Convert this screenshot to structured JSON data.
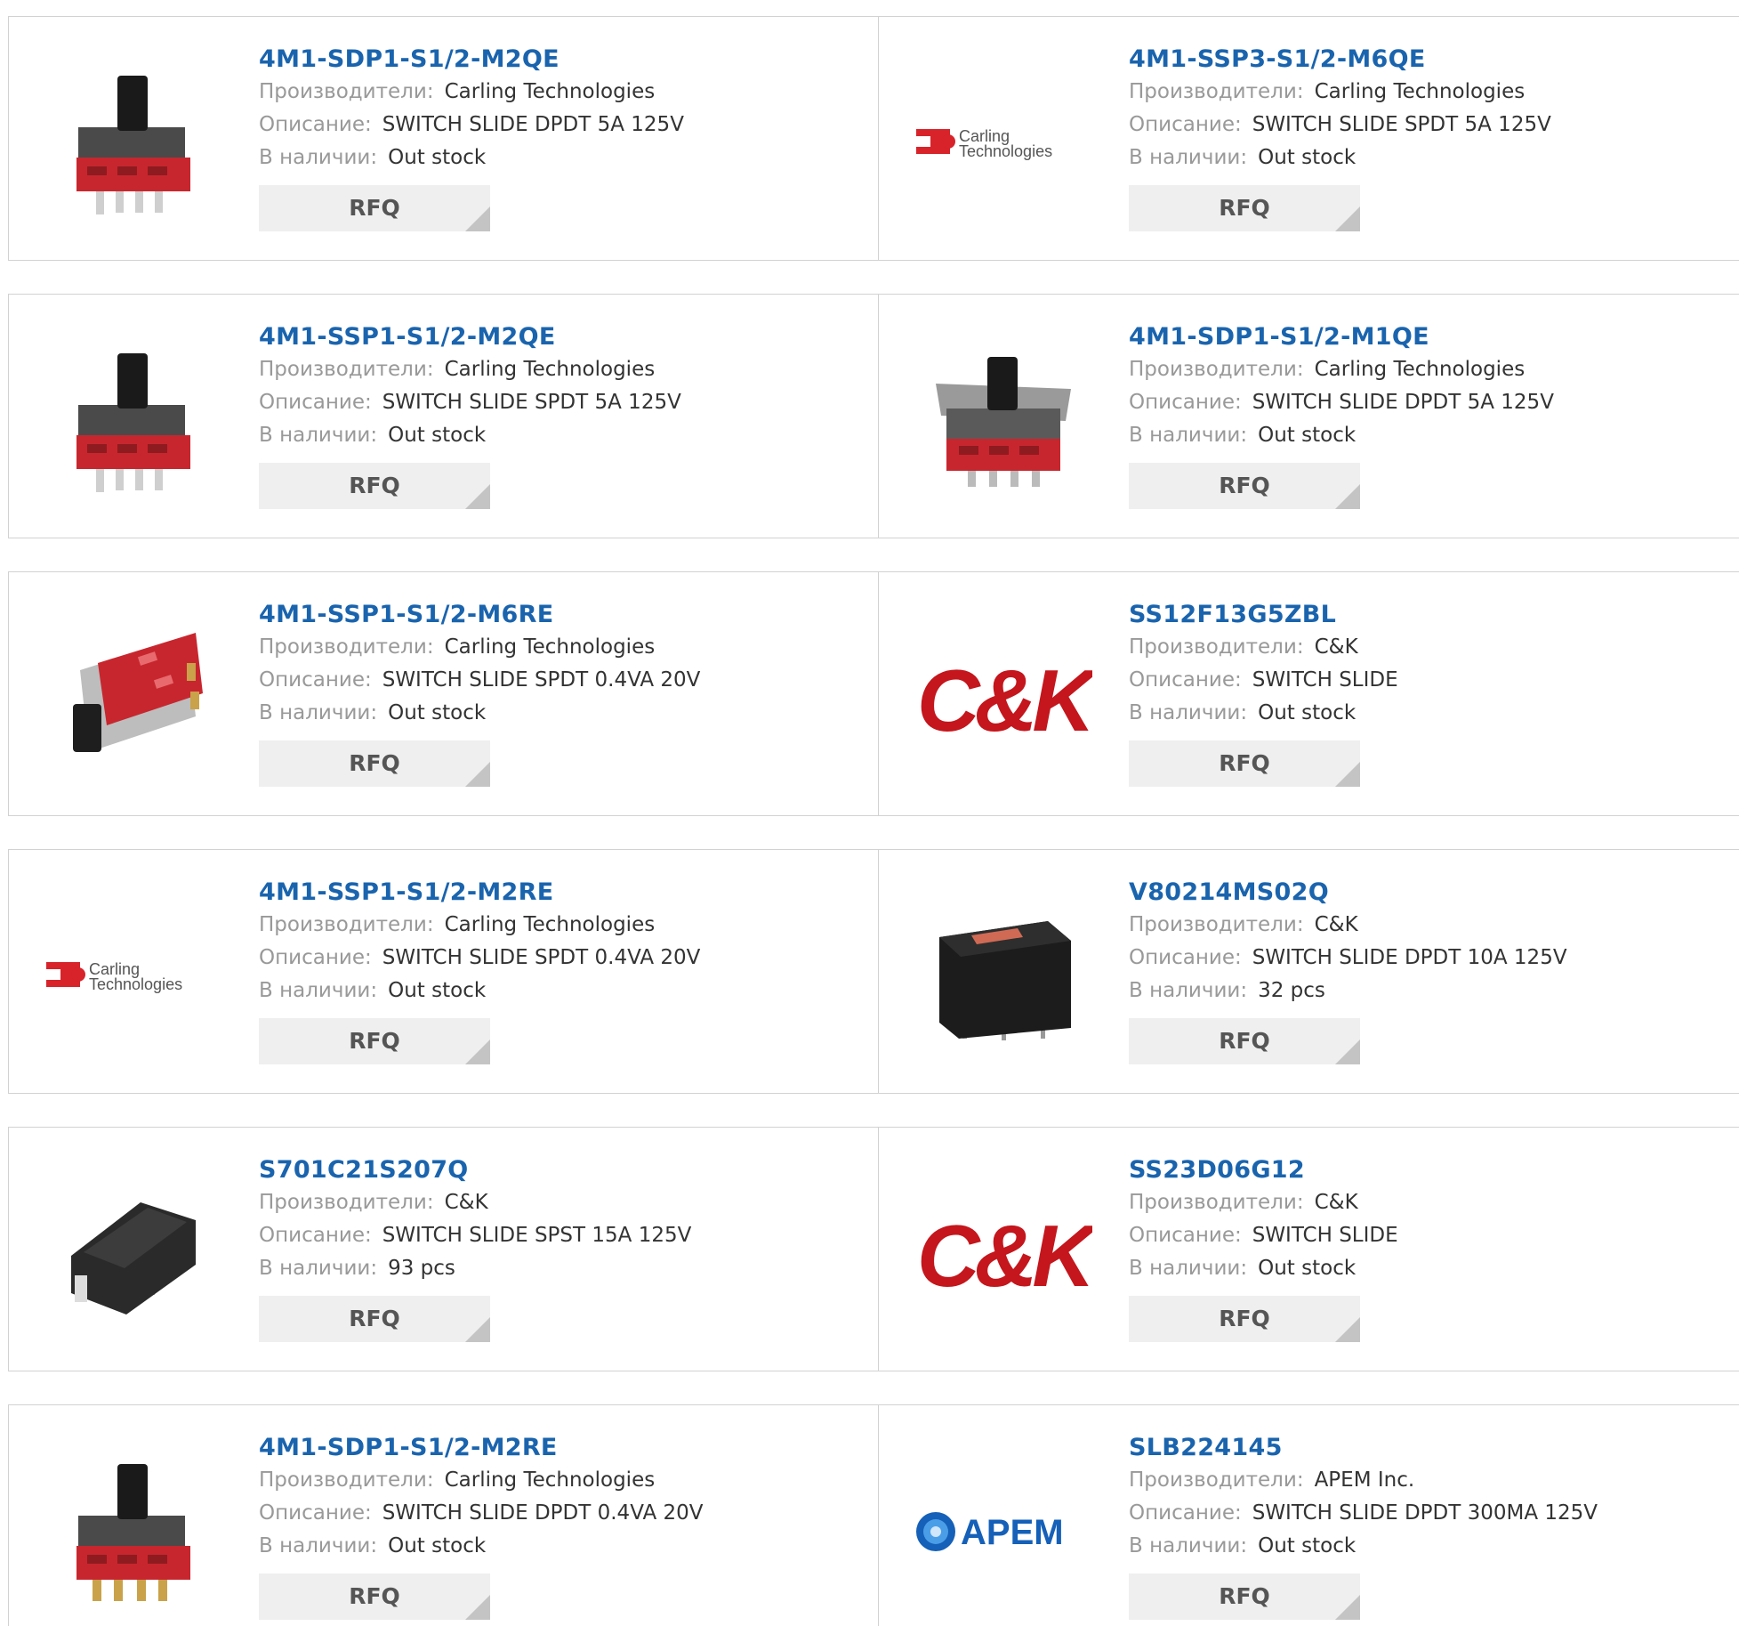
{
  "labels": {
    "manufacturer": "Производители:",
    "description": "Описание:",
    "stock": "В наличии:",
    "rfq": "RFQ"
  },
  "products": [
    {
      "part": "4M1-SDP1-S1/2-M2QE",
      "manufacturer": "Carling Technologies",
      "description": "SWITCH SLIDE DPDT 5A 125V",
      "stock": "Out stock",
      "image": "slide-switch-photo"
    },
    {
      "part": "4M1-SSP3-S1/2-M6QE",
      "manufacturer": "Carling Technologies",
      "description": "SWITCH SLIDE SPDT 5A 125V",
      "stock": "Out stock",
      "image": "carling-logo",
      "logo_text": [
        "Carling",
        "Technologies"
      ]
    },
    {
      "part": "4M1-SSP1-S1/2-M2QE",
      "manufacturer": "Carling Technologies",
      "description": "SWITCH SLIDE SPDT 5A 125V",
      "stock": "Out stock",
      "image": "slide-switch-photo"
    },
    {
      "part": "4M1-SDP1-S1/2-M1QE",
      "manufacturer": "Carling Technologies",
      "description": "SWITCH SLIDE DPDT 5A 125V",
      "stock": "Out stock",
      "image": "slide-switch-bracket-photo"
    },
    {
      "part": "4M1-SSP1-S1/2-M6RE",
      "manufacturer": "Carling Technologies",
      "description": "SWITCH SLIDE SPDT 0.4VA 20V",
      "stock": "Out stock",
      "image": "right-angle-switch-photo"
    },
    {
      "part": "SS12F13G5ZBL",
      "manufacturer": "C&K",
      "description": "SWITCH SLIDE",
      "stock": "Out stock",
      "image": "ck-logo",
      "logo_text": [
        "C&K"
      ]
    },
    {
      "part": "4M1-SSP1-S1/2-M2RE",
      "manufacturer": "Carling Technologies",
      "description": "SWITCH SLIDE SPDT 0.4VA 20V",
      "stock": "Out stock",
      "image": "carling-logo",
      "logo_text": [
        "Carling",
        "Technologies"
      ]
    },
    {
      "part": "V80214MS02Q",
      "manufacturer": "C&K",
      "description": "SWITCH SLIDE DPDT 10A 125V",
      "stock": "32 pcs",
      "image": "black-block-switch-photo"
    },
    {
      "part": "S701C21S207Q",
      "manufacturer": "C&K",
      "description": "SWITCH SLIDE SPST 15A 125V",
      "stock": "93 pcs",
      "image": "rocker-switch-photo"
    },
    {
      "part": "SS23D06G12",
      "manufacturer": "C&K",
      "description": "SWITCH SLIDE",
      "stock": "Out stock",
      "image": "ck-logo",
      "logo_text": [
        "C&K"
      ]
    },
    {
      "part": "4M1-SDP1-S1/2-M2RE",
      "manufacturer": "Carling Technologies",
      "description": "SWITCH SLIDE DPDT 0.4VA 20V",
      "stock": "Out stock",
      "image": "slide-switch-gold-photo"
    },
    {
      "part": "SLB224145",
      "manufacturer": "APEM Inc.",
      "description": "SWITCH SLIDE DPDT 300MA 125V",
      "stock": "Out stock",
      "image": "apem-logo",
      "logo_text": [
        "APEM"
      ]
    }
  ],
  "colors": {
    "title": "#1a64ae",
    "label": "#999999",
    "value": "#333333",
    "button_bg": "#efefef",
    "border": "#d2d2d2",
    "switch_red": "#c8262e",
    "carling_red": "#d8232a",
    "ck_red": "#c4161c",
    "apem_blue": "#1560b8"
  }
}
